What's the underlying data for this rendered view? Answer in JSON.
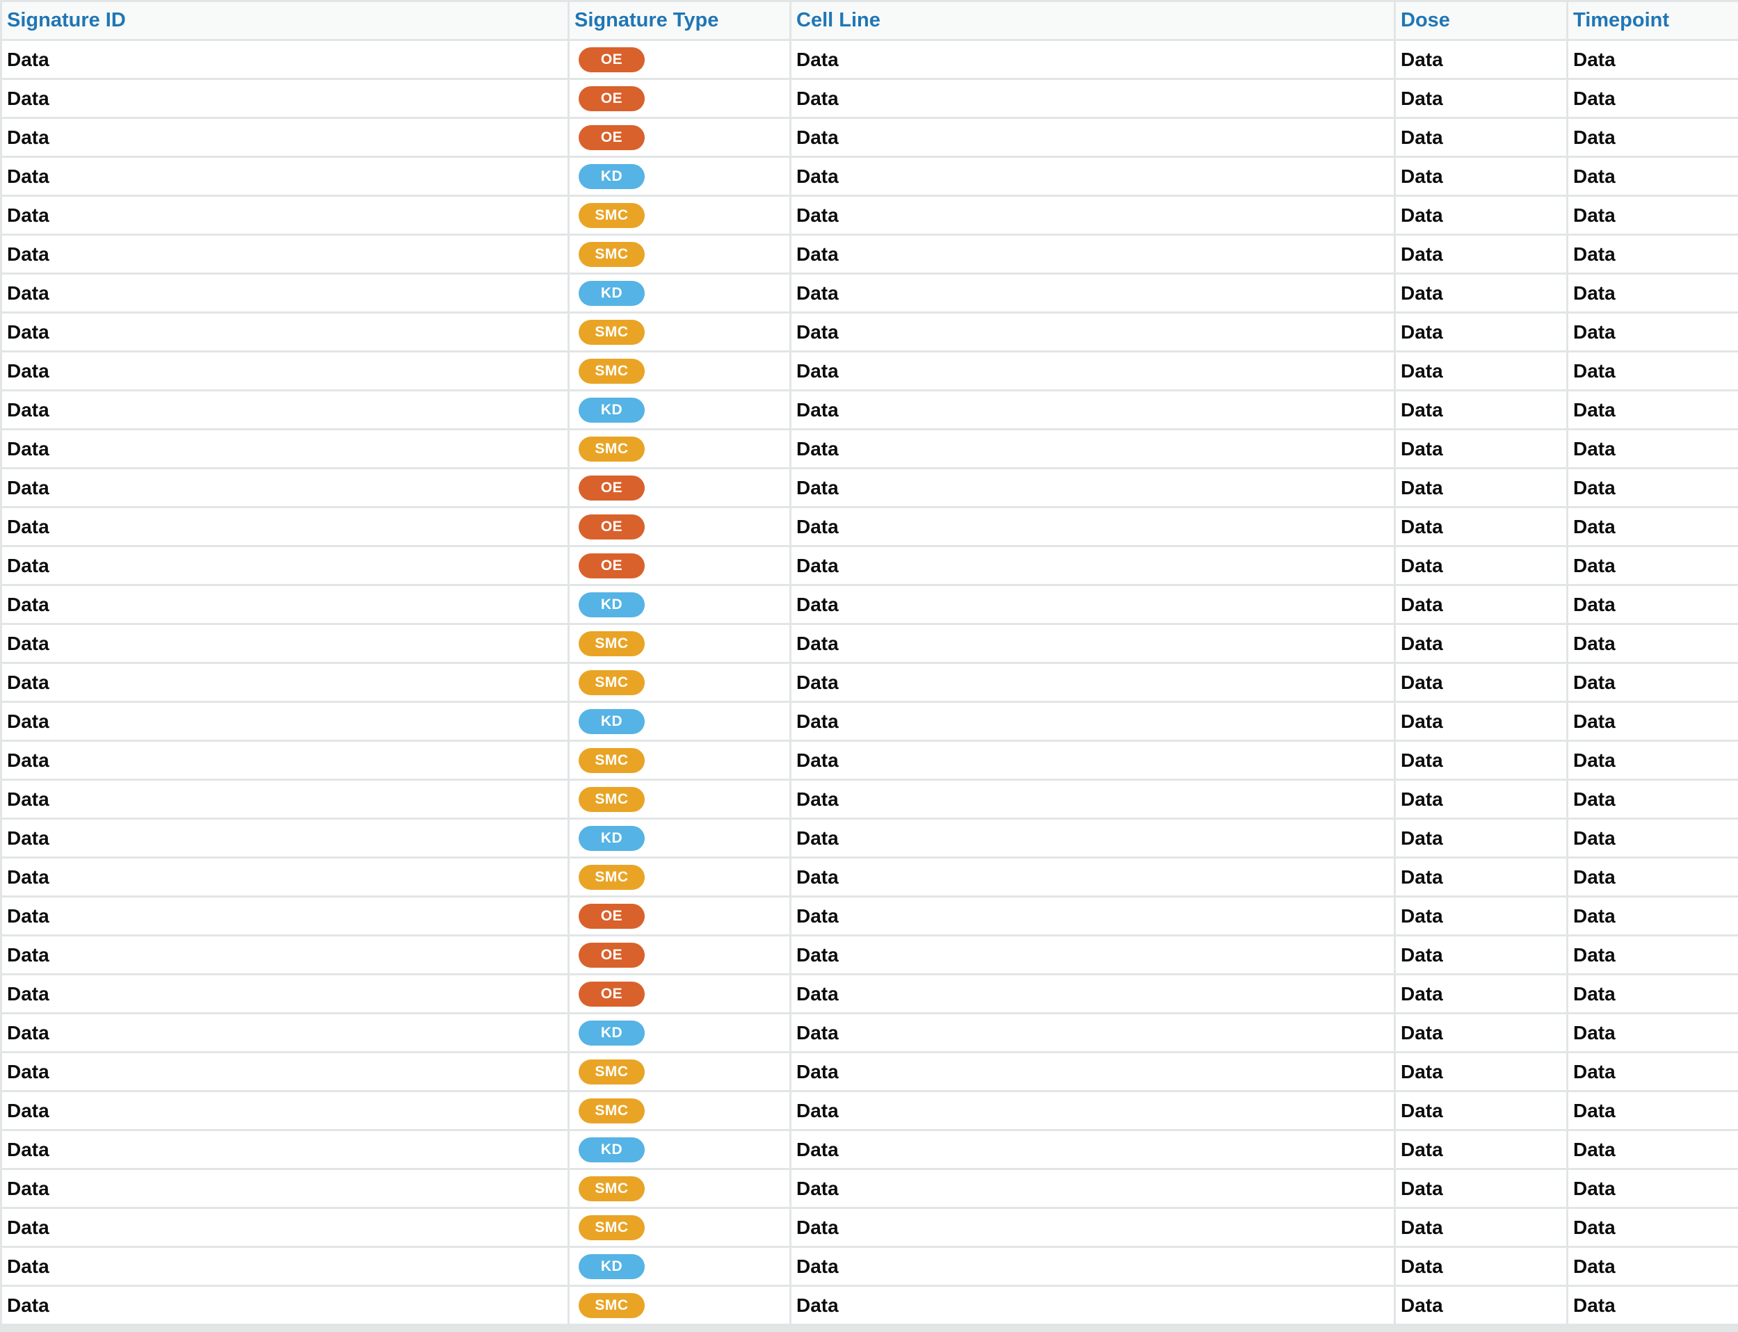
{
  "table": {
    "columns": [
      "Signature ID",
      "Signature Type",
      "Cell Line",
      "Dose",
      "Timepoint"
    ],
    "type_colors": {
      "OE": "#d9612b",
      "KD": "#55b3e5",
      "SMC": "#e9a426"
    },
    "rows": [
      {
        "signature_id": "Data",
        "type": "OE",
        "cell_line": "Data",
        "dose": "Data",
        "timepoint": "Data"
      },
      {
        "signature_id": "Data",
        "type": "OE",
        "cell_line": "Data",
        "dose": "Data",
        "timepoint": "Data"
      },
      {
        "signature_id": "Data",
        "type": "OE",
        "cell_line": "Data",
        "dose": "Data",
        "timepoint": "Data"
      },
      {
        "signature_id": "Data",
        "type": "KD",
        "cell_line": "Data",
        "dose": "Data",
        "timepoint": "Data"
      },
      {
        "signature_id": "Data",
        "type": "SMC",
        "cell_line": "Data",
        "dose": "Data",
        "timepoint": "Data"
      },
      {
        "signature_id": "Data",
        "type": "SMC",
        "cell_line": "Data",
        "dose": "Data",
        "timepoint": "Data"
      },
      {
        "signature_id": "Data",
        "type": "KD",
        "cell_line": "Data",
        "dose": "Data",
        "timepoint": "Data"
      },
      {
        "signature_id": "Data",
        "type": "SMC",
        "cell_line": "Data",
        "dose": "Data",
        "timepoint": "Data"
      },
      {
        "signature_id": "Data",
        "type": "SMC",
        "cell_line": "Data",
        "dose": "Data",
        "timepoint": "Data"
      },
      {
        "signature_id": "Data",
        "type": "KD",
        "cell_line": "Data",
        "dose": "Data",
        "timepoint": "Data"
      },
      {
        "signature_id": "Data",
        "type": "SMC",
        "cell_line": "Data",
        "dose": "Data",
        "timepoint": "Data"
      },
      {
        "signature_id": "Data",
        "type": "OE",
        "cell_line": "Data",
        "dose": "Data",
        "timepoint": "Data"
      },
      {
        "signature_id": "Data",
        "type": "OE",
        "cell_line": "Data",
        "dose": "Data",
        "timepoint": "Data"
      },
      {
        "signature_id": "Data",
        "type": "OE",
        "cell_line": "Data",
        "dose": "Data",
        "timepoint": "Data"
      },
      {
        "signature_id": "Data",
        "type": "KD",
        "cell_line": "Data",
        "dose": "Data",
        "timepoint": "Data"
      },
      {
        "signature_id": "Data",
        "type": "SMC",
        "cell_line": "Data",
        "dose": "Data",
        "timepoint": "Data"
      },
      {
        "signature_id": "Data",
        "type": "SMC",
        "cell_line": "Data",
        "dose": "Data",
        "timepoint": "Data"
      },
      {
        "signature_id": "Data",
        "type": "KD",
        "cell_line": "Data",
        "dose": "Data",
        "timepoint": "Data"
      },
      {
        "signature_id": "Data",
        "type": "SMC",
        "cell_line": "Data",
        "dose": "Data",
        "timepoint": "Data"
      },
      {
        "signature_id": "Data",
        "type": "SMC",
        "cell_line": "Data",
        "dose": "Data",
        "timepoint": "Data"
      },
      {
        "signature_id": "Data",
        "type": "KD",
        "cell_line": "Data",
        "dose": "Data",
        "timepoint": "Data"
      },
      {
        "signature_id": "Data",
        "type": "SMC",
        "cell_line": "Data",
        "dose": "Data",
        "timepoint": "Data"
      },
      {
        "signature_id": "Data",
        "type": "OE",
        "cell_line": "Data",
        "dose": "Data",
        "timepoint": "Data"
      },
      {
        "signature_id": "Data",
        "type": "OE",
        "cell_line": "Data",
        "dose": "Data",
        "timepoint": "Data"
      },
      {
        "signature_id": "Data",
        "type": "OE",
        "cell_line": "Data",
        "dose": "Data",
        "timepoint": "Data"
      },
      {
        "signature_id": "Data",
        "type": "KD",
        "cell_line": "Data",
        "dose": "Data",
        "timepoint": "Data"
      },
      {
        "signature_id": "Data",
        "type": "SMC",
        "cell_line": "Data",
        "dose": "Data",
        "timepoint": "Data"
      },
      {
        "signature_id": "Data",
        "type": "SMC",
        "cell_line": "Data",
        "dose": "Data",
        "timepoint": "Data"
      },
      {
        "signature_id": "Data",
        "type": "KD",
        "cell_line": "Data",
        "dose": "Data",
        "timepoint": "Data"
      },
      {
        "signature_id": "Data",
        "type": "SMC",
        "cell_line": "Data",
        "dose": "Data",
        "timepoint": "Data"
      },
      {
        "signature_id": "Data",
        "type": "SMC",
        "cell_line": "Data",
        "dose": "Data",
        "timepoint": "Data"
      },
      {
        "signature_id": "Data",
        "type": "KD",
        "cell_line": "Data",
        "dose": "Data",
        "timepoint": "Data"
      },
      {
        "signature_id": "Data",
        "type": "SMC",
        "cell_line": "Data",
        "dose": "Data",
        "timepoint": "Data"
      }
    ]
  }
}
